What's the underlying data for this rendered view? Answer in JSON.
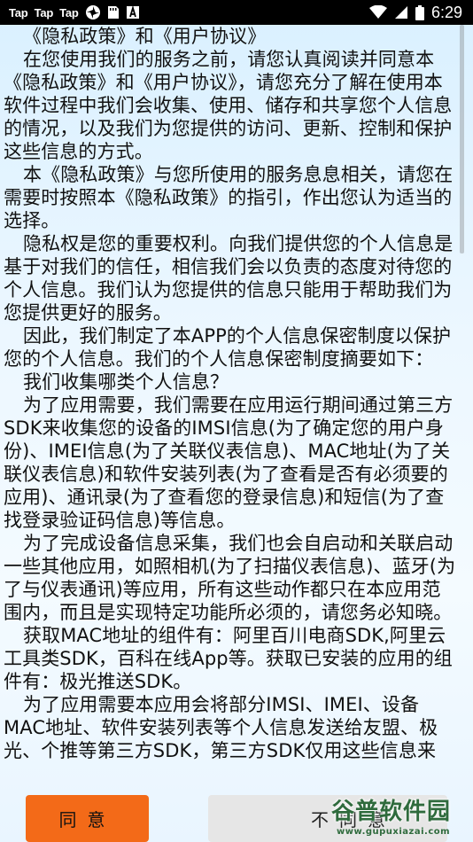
{
  "status_bar": {
    "tap_labels": [
      "Tap",
      "Tap",
      "Tap"
    ],
    "time": "6:29"
  },
  "policy": {
    "paragraphs": [
      "《隐私政策》和《用户协议》",
      "在您使用我们的服务之前，请您认真阅读并同意本《隐私政策》和《用户协议》，请您充分了解在使用本软件过程中我们会收集、使用、储存和共享您个人信息的情况，以及我们为您提供的访问、更新、控制和保护这些信息的方式。",
      "本《隐私政策》与您所使用的服务息息相关，请您在需要时按照本《隐私政策》的指引，作出您认为适当的选择。",
      "隐私权是您的重要权利。向我们提供您的个人信息是基于对我们的信任，相信我们会以负责的态度对待您的个人信息。我们认为您提供的信息只能用于帮助我们为您提供更好的服务。",
      "因此，我们制定了本APP的个人信息保密制度以保护您的个人信息。我们的个人信息保密制度摘要如下：",
      "我们收集哪类个人信息？",
      "为了应用需要，我们需要在应用运行期间通过第三方SDK来收集您的设备的IMSI信息(为了确定您的用户身份)、IMEI信息(为了关联仪表信息)、MAC地址(为了关联仪表信息)和软件安装列表(为了查看是否有必须要的应用)、通讯录(为了查看您的登录信息)和短信(为了查找登录验证码信息)等信息。",
      "为了完成设备信息采集，我们也会自启动和关联启动一些其他应用，如照相机(为了扫描仪表信息)、蓝牙(为了与仪表通讯)等应用，所有这些动作都只在本应用范围内，而且是实现特定功能所必须的，请您务必知晓。",
      "获取MAC地址的组件有：阿里百川电商SDK,阿里云工具类SDK，百科在线App等。获取已安装的应用的组件有：极光推送SDK。",
      "为了应用需要本应用会将部分IMSI、IMEI、设备MAC地址、软件安装列表等个人信息发送给友盟、极光、个推等第三方SDK，第三方SDK仅用这些信息来"
    ]
  },
  "buttons": {
    "agree": "同意",
    "disagree": "不同意"
  },
  "watermark": {
    "title": "谷普软件园",
    "url": "www.gupuxiazai.com"
  }
}
